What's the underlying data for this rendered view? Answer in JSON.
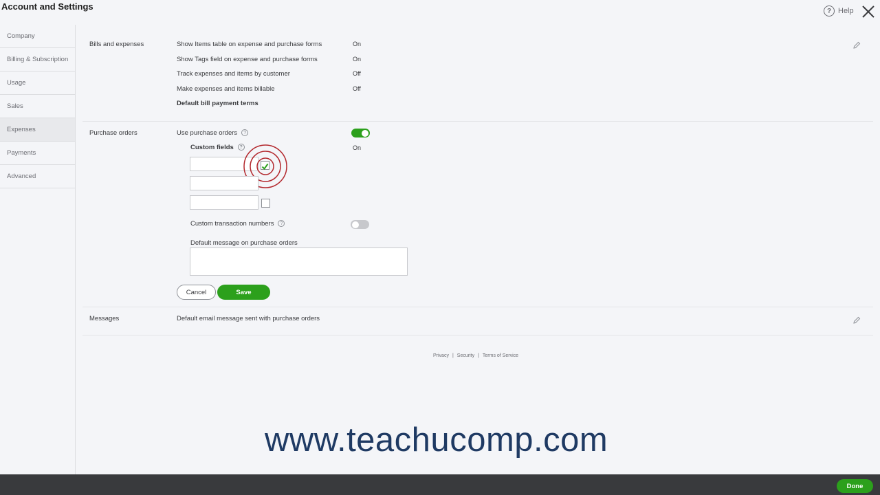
{
  "header": {
    "title": "Account and Settings",
    "help_label": "Help"
  },
  "sidebar": {
    "items": [
      {
        "label": "Company"
      },
      {
        "label": "Billing & Subscription"
      },
      {
        "label": "Usage"
      },
      {
        "label": "Sales"
      },
      {
        "label": "Expenses"
      },
      {
        "label": "Payments"
      },
      {
        "label": "Advanced"
      }
    ],
    "active_index": 4
  },
  "bills": {
    "title": "Bills and expenses",
    "rows": [
      {
        "label": "Show Items table on expense and purchase forms",
        "value": "On"
      },
      {
        "label": "Show Tags field on expense and purchase forms",
        "value": "On"
      },
      {
        "label": "Track expenses and items by customer",
        "value": "Off"
      },
      {
        "label": "Make expenses and items billable",
        "value": "Off"
      }
    ],
    "terms_label": "Default bill payment terms"
  },
  "purchase_orders": {
    "title": "Purchase orders",
    "use_label": "Use purchase orders",
    "use_enabled": true,
    "custom_fields_label": "Custom fields",
    "custom_fields_value": "On",
    "custom_fields": [
      {
        "value": "",
        "checked": true
      },
      {
        "value": "",
        "checked": false
      },
      {
        "value": "",
        "checked": false
      }
    ],
    "txn_numbers_label": "Custom transaction numbers",
    "txn_numbers_enabled": false,
    "default_message_label": "Default message on purchase orders",
    "default_message_value": "",
    "cancel_label": "Cancel",
    "save_label": "Save"
  },
  "messages": {
    "title": "Messages",
    "row_label": "Default email message sent with purchase orders"
  },
  "footer": {
    "privacy": "Privacy",
    "security": "Security",
    "terms": "Terms of Service",
    "separator": "|"
  },
  "watermark": "www.teachucomp.com",
  "bottom": {
    "done_label": "Done"
  },
  "colors": {
    "accent_green": "#2ca01c",
    "bottom_bar": "#393a3d",
    "watermark": "#1f3a63",
    "click_indicator": "#b3282d"
  }
}
